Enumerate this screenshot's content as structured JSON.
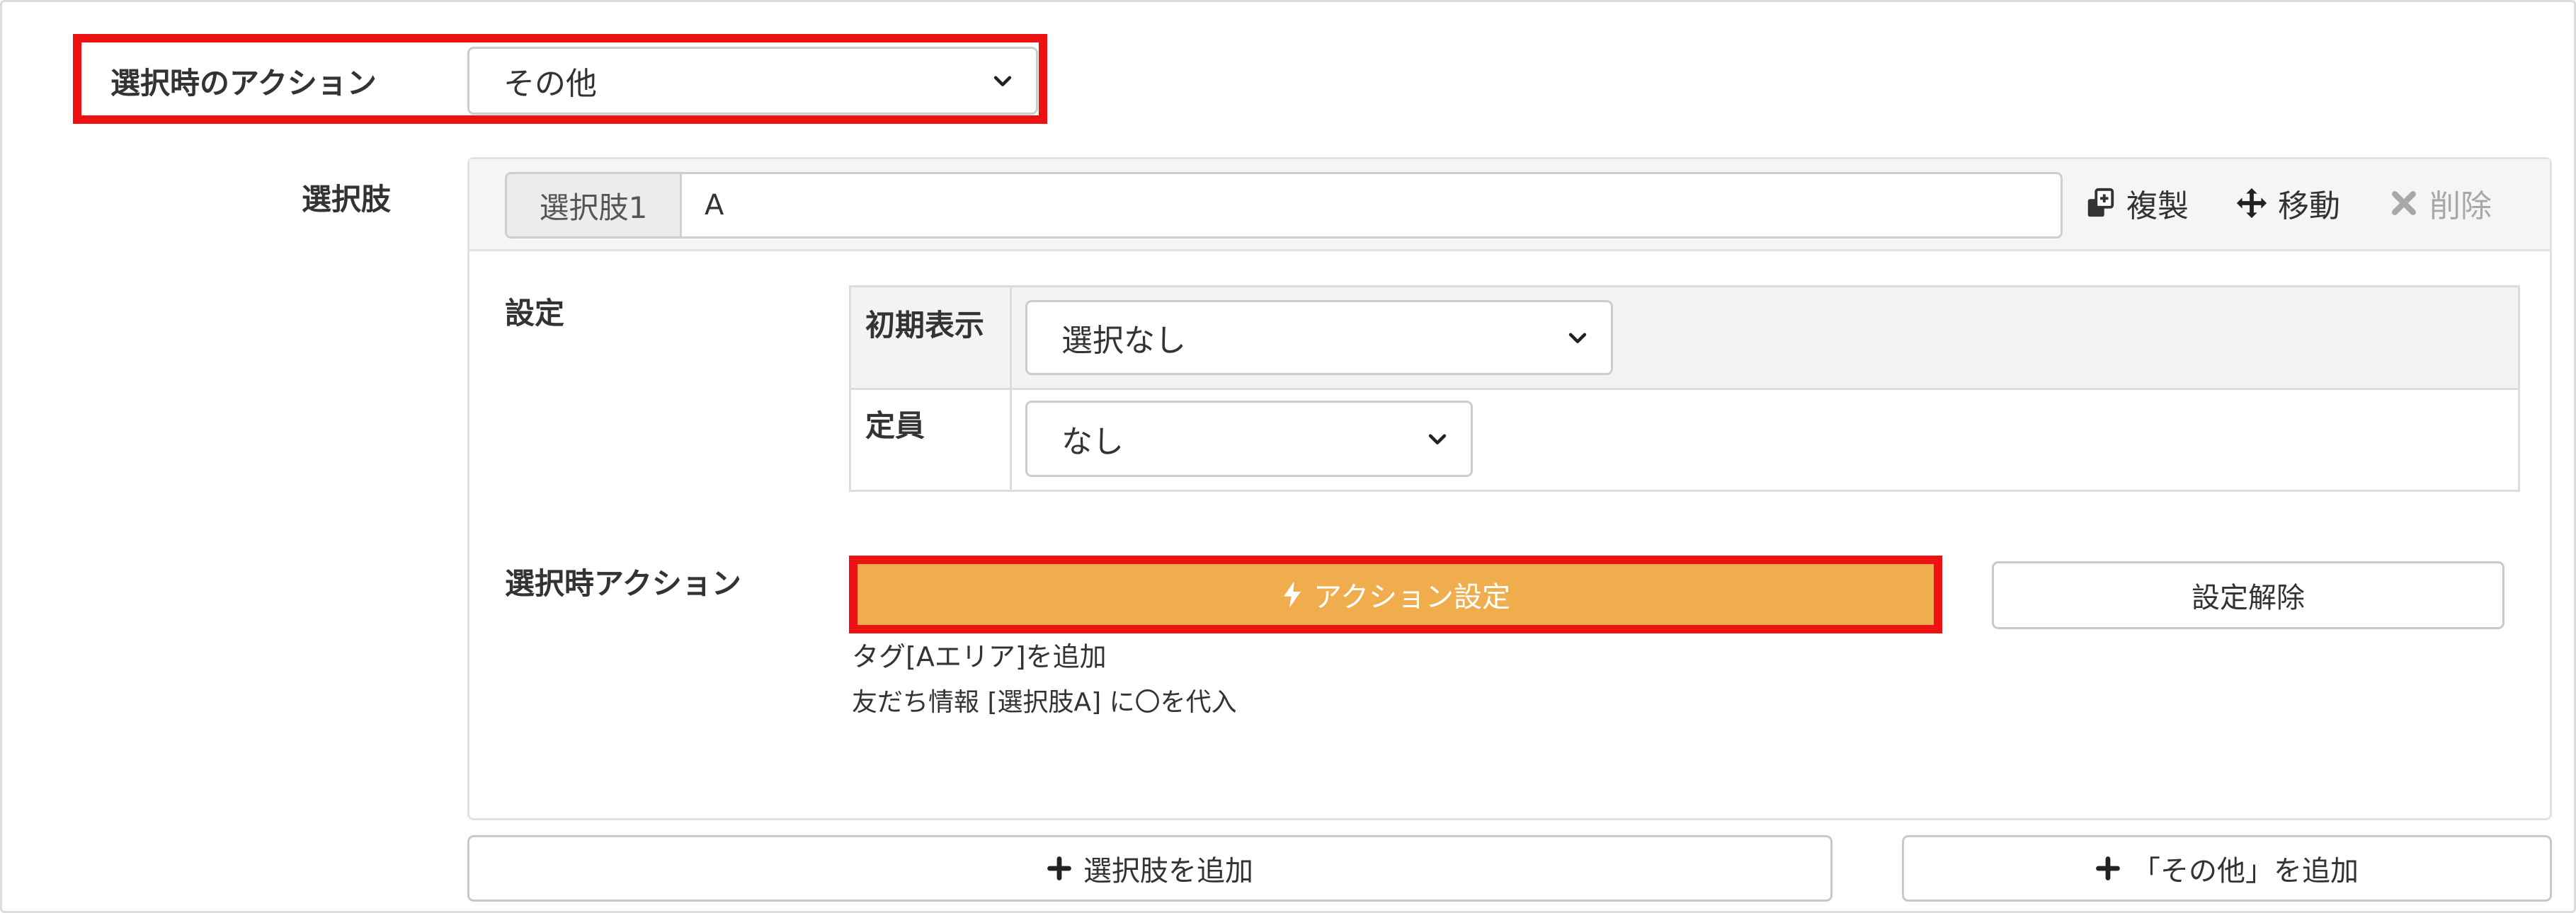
{
  "action_on_select": {
    "label": "選択時のアクション",
    "selected": "その他"
  },
  "choices": {
    "label": "選択肢",
    "item": {
      "addon": "選択肢1",
      "value": "A",
      "duplicate_label": "複製",
      "move_label": "移動",
      "delete_label": "削除"
    },
    "settings": {
      "label": "設定",
      "initial_display": {
        "label": "初期表示",
        "selected": "選択なし"
      },
      "capacity": {
        "label": "定員",
        "selected": "なし"
      }
    },
    "selection_action": {
      "label": "選択時アクション",
      "set_button": "アクション設定",
      "clear_button": "設定解除",
      "notes": [
        "タグ[Aエリア]を追加",
        "友だち情報 [選択肢A] に〇を代入"
      ]
    }
  },
  "footer": {
    "add_choice": "選択肢を追加",
    "add_other": "「その他」を追加"
  },
  "colors": {
    "highlight": "#ee1111",
    "action_button": "#f0ad4e"
  }
}
